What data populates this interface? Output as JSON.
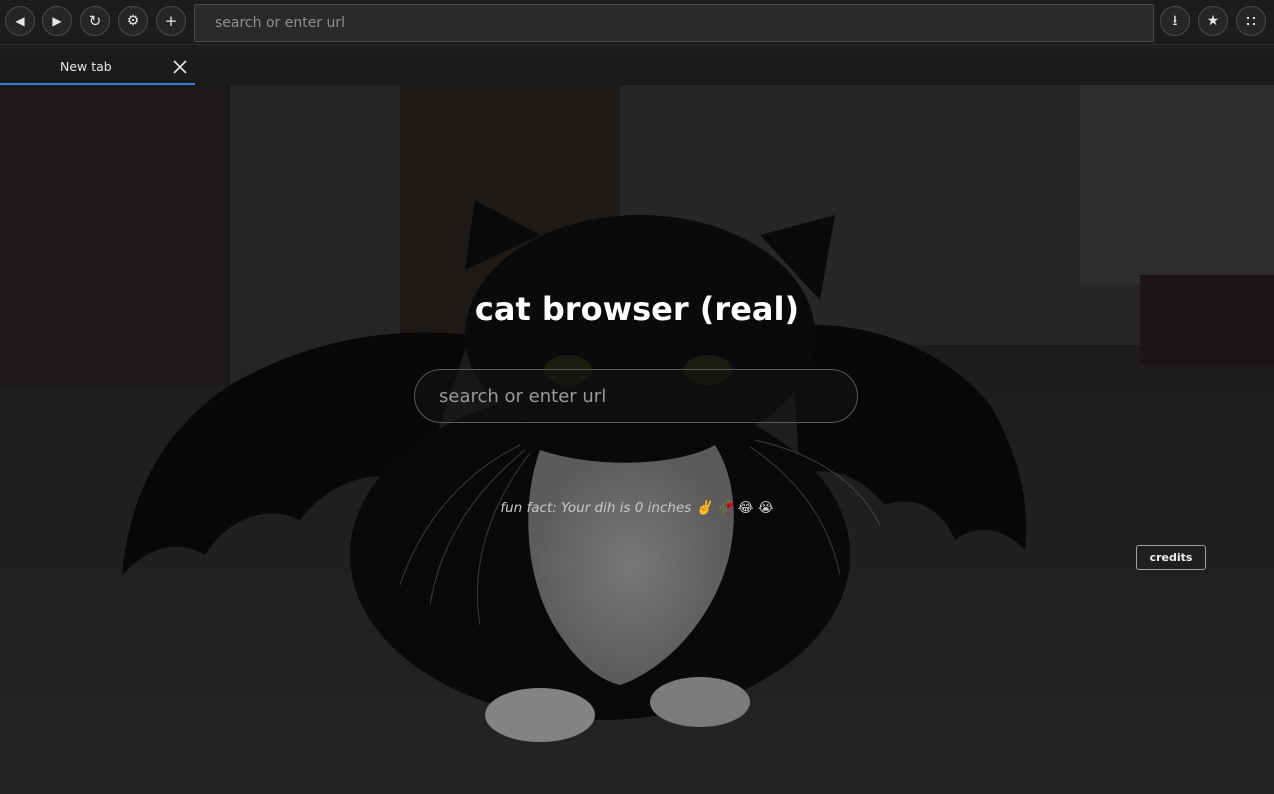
{
  "toolbar": {
    "back_icon": "◀",
    "forward_icon": "▶",
    "reload_icon": "↻",
    "settings_icon": "⚙",
    "new_tab_icon": "+",
    "url_placeholder": "search or enter url",
    "downloads_icon": "⭳",
    "bookmark_icon": "★",
    "fullscreen_icon": "⛶"
  },
  "tabs": [
    {
      "label": "New tab",
      "active": true
    }
  ],
  "page": {
    "title": "cat browser (real)",
    "search_placeholder": "search or enter url",
    "fun_fact": "fun fact: Your dih is 0 inches ✌️ 🥀 😂 😭",
    "credits_label": "credits"
  },
  "colors": {
    "accent": "#2f7fd6",
    "toolbar_bg": "#1c1c1c",
    "page_bg": "#2b2b2b"
  }
}
